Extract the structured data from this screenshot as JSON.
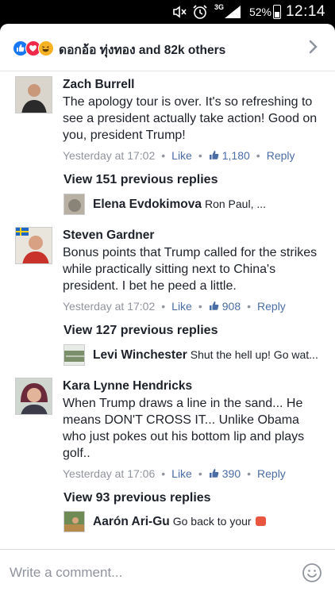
{
  "status_bar": {
    "network": "3G",
    "battery": "52%",
    "time": "12:14"
  },
  "reactions": {
    "summary": "ดอกอ้อ ทุ่งทอง and 82k others"
  },
  "comments": [
    {
      "name": "Zach Burrell",
      "text": "The apology tour is over. It's so refreshing to see a president actually take action! Good on you, president Trump!",
      "time": "Yesterday at 17:02",
      "like_label": "Like",
      "like_count": "1,180",
      "reply_label": "Reply",
      "view_replies": "View 151 previous replies",
      "reply_preview": {
        "name": "Elena Evdokimova",
        "text": "Ron Paul, ..."
      }
    },
    {
      "name": "Steven Gardner",
      "text": "Bonus points that Trump called for the strikes while practically sitting next to China's president. I bet he peed a little.",
      "time": "Yesterday at 17:02",
      "like_label": "Like",
      "like_count": "908",
      "reply_label": "Reply",
      "view_replies": "View 127 previous replies",
      "reply_preview": {
        "name": "Levi Winchester",
        "text": "Shut the hell up! Go wat..."
      }
    },
    {
      "name": "Kara Lynne Hendricks",
      "text": "When Trump draws a line in the sand... He means DON'T CROSS IT... Unlike Obama who just pokes out his bottom lip and plays golf..",
      "time": "Yesterday at 17:06",
      "like_label": "Like",
      "like_count": "390",
      "reply_label": "Reply",
      "view_replies": "View 93 previous replies",
      "reply_preview": {
        "name": "Aarón Ari-Gu",
        "text": "Go back to your"
      }
    }
  ],
  "composer": {
    "placeholder": "Write a comment..."
  },
  "colors": {
    "link": "#4b6da6",
    "meta": "#90949c",
    "text": "#1d2129",
    "like_blue": "#1877f2",
    "love_red": "#f0284a",
    "haha_yellow": "#f7b125"
  }
}
